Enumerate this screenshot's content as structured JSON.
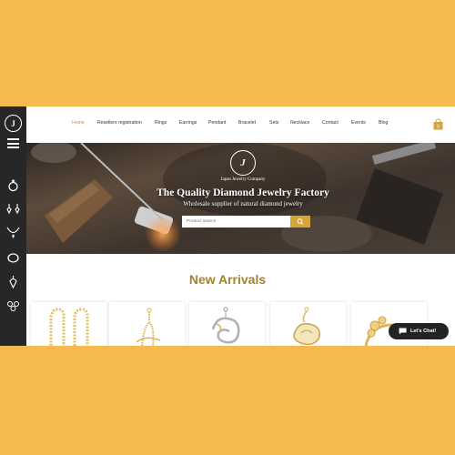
{
  "brand": {
    "logo_text": "J"
  },
  "nav": {
    "items": [
      {
        "label": "Home",
        "active": true
      },
      {
        "label": "Resellers registration"
      },
      {
        "label": "Rings"
      },
      {
        "label": "Earrings"
      },
      {
        "label": "Pendant"
      },
      {
        "label": "Bracelet"
      },
      {
        "label": "Sets"
      },
      {
        "label": "Necklace"
      },
      {
        "label": "Contact"
      },
      {
        "label": "Events"
      },
      {
        "label": "Blog"
      }
    ],
    "cart_count": "0"
  },
  "sidebar": {
    "icons": [
      "ring-icon",
      "earrings-icon",
      "necklace-icon",
      "bracelet-icon",
      "pendant-icon",
      "set-icon"
    ]
  },
  "hero": {
    "logo_text": "J",
    "company": "Japan Jewelry Company",
    "title": "The Quality Diamond Jewelry Factory",
    "subtitle": "Wholesale supplier of natural diamond jewelry",
    "search_placeholder": "Product search"
  },
  "section": {
    "title": "New Arrivals"
  },
  "products": [
    {
      "name": "hoop-earrings"
    },
    {
      "name": "diamond-pendant"
    },
    {
      "name": "dragon-pendant"
    },
    {
      "name": "swan-pendant"
    },
    {
      "name": "floral-ring"
    }
  ],
  "chat": {
    "label": "Let's Chat!"
  },
  "colors": {
    "accent": "#c9962f",
    "sidebar": "#272727",
    "background": "#f4b94f",
    "title": "#a4812f"
  }
}
